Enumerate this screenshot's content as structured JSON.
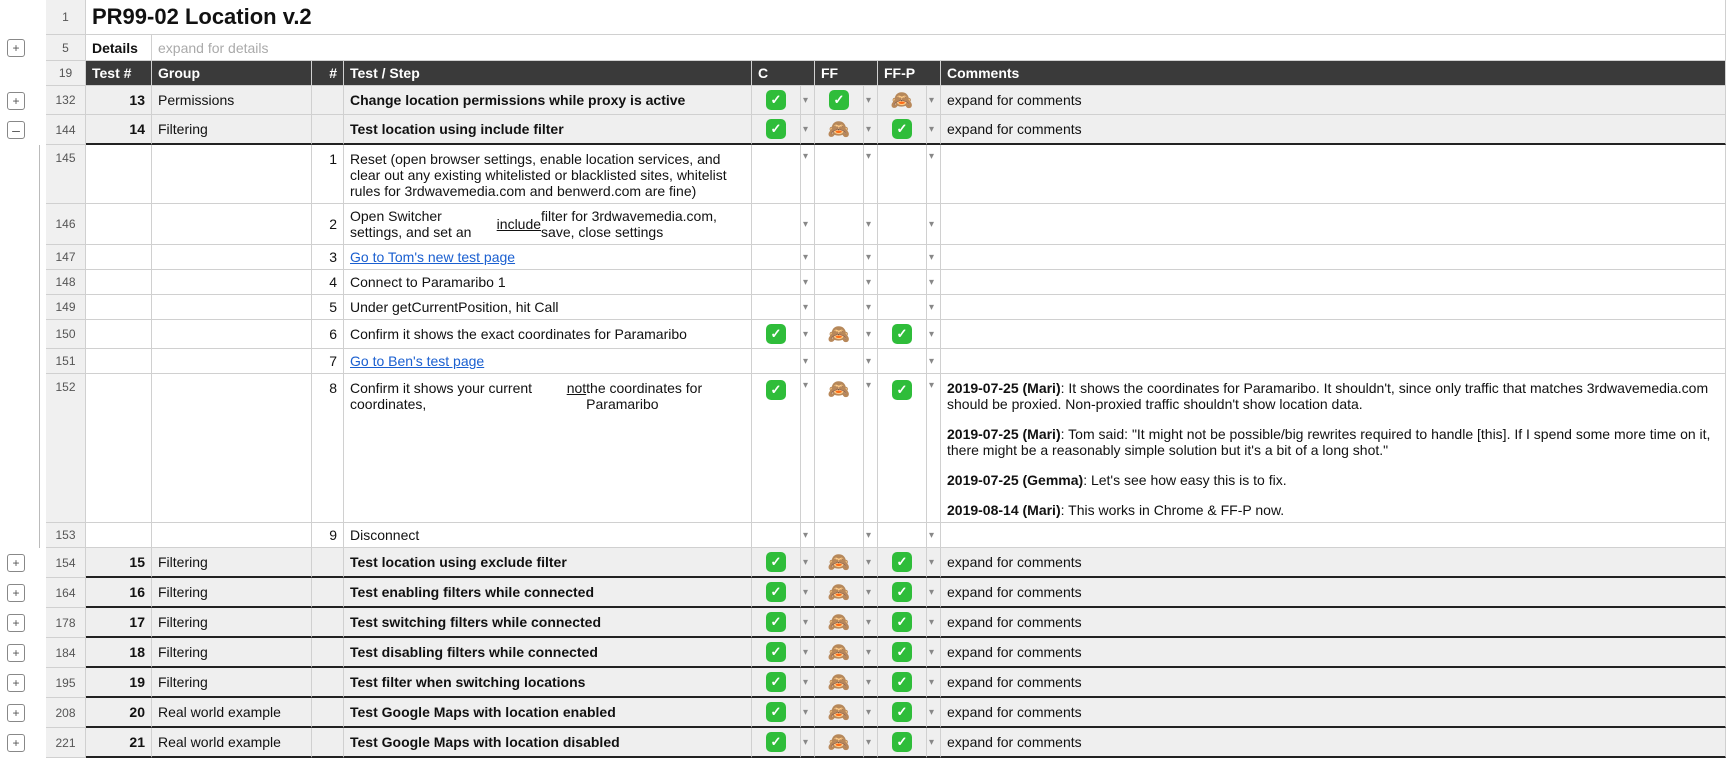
{
  "icons": {
    "pass": "✓",
    "monkey": "🙈",
    "dd": "▾",
    "plus": "+",
    "minus": "–"
  },
  "title": "PR99-02 Location v.2",
  "detailsLabel": "Details",
  "detailsHint": "expand for details",
  "headers": {
    "test": "Test #",
    "group": "Group",
    "num": "#",
    "step": "Test / Step",
    "c": "C",
    "ff": "FF",
    "ffp": "FF-P",
    "comments": "Comments"
  },
  "rownums": {
    "r1": "1",
    "r5": "5",
    "r19": "19"
  },
  "expandComments": "expand for comments",
  "rows": [
    {
      "rn": "132",
      "test": "13",
      "group": "Permissions",
      "num": "",
      "step": "Change location permissions while proxy is active",
      "bold": true,
      "sec": true,
      "c": "pass",
      "ff": "pass",
      "ffp": "monkey",
      "comments": "expand"
    },
    {
      "rn": "144",
      "test": "14",
      "group": "Filtering",
      "num": "",
      "step": "Test location using include filter",
      "bold": true,
      "sec": true,
      "c": "pass",
      "ff": "monkey",
      "ffp": "pass",
      "comments": "expand",
      "topb": true
    },
    {
      "rn": "145",
      "test": "",
      "group": "",
      "num": "1",
      "step": "Reset (open browser settings, enable location services, and clear out any existing whitelisted or blacklisted sites, whitelist rules for 3rdwavemedia.com and benwerd.com are fine)",
      "tall": true
    },
    {
      "rn": "146",
      "test": "",
      "group": "",
      "num": "2",
      "stepParts": [
        "Open Switcher settings, and set an ",
        {
          "u": "include"
        },
        " filter for 3rdwavemedia.com, save, close settings"
      ]
    },
    {
      "rn": "147",
      "test": "",
      "group": "",
      "num": "3",
      "stepLink": "Go to Tom's new test page"
    },
    {
      "rn": "148",
      "test": "",
      "group": "",
      "num": "4",
      "step": "Connect to Paramaribo 1"
    },
    {
      "rn": "149",
      "test": "",
      "group": "",
      "num": "5",
      "step": "Under getCurrentPosition, hit Call"
    },
    {
      "rn": "150",
      "test": "",
      "group": "",
      "num": "6",
      "step": "Confirm it shows the exact coordinates for Paramaribo",
      "c": "pass",
      "ff": "monkey",
      "ffp": "pass"
    },
    {
      "rn": "151",
      "test": "",
      "group": "",
      "num": "7",
      "stepLink": "Go to Ben's test page"
    },
    {
      "rn": "152",
      "test": "",
      "group": "",
      "num": "8",
      "stepParts": [
        "Confirm it shows your current coordinates, ",
        {
          "u": "not"
        },
        " the coordinates for Paramaribo"
      ],
      "c": "pass",
      "ff": "monkey",
      "ffp": "pass",
      "commentsRich": [
        {
          "b": "2019-07-25 (Mari)",
          "t": ": It shows the coordinates for Paramaribo. It shouldn't, since only traffic that matches 3rdwavemedia.com should be proxied. Non-proxied traffic shouldn't show location data."
        },
        {
          "b": "2019-07-25 (Mari)",
          "t": ": Tom said: \"It might not be possible/big rewrites required to handle [this]. If I spend some more time on it, there might be a reasonably simple solution but it's a bit of a long shot.\""
        },
        {
          "b": "2019-07-25 (Gemma)",
          "t": ": Let's see how easy this is to fix."
        },
        {
          "b": "2019-08-14 (Mari)",
          "t": ": This works in Chrome & FF-P now."
        }
      ],
      "tall": true
    },
    {
      "rn": "153",
      "test": "",
      "group": "",
      "num": "9",
      "step": "Disconnect"
    },
    {
      "rn": "154",
      "test": "15",
      "group": "Filtering",
      "num": "",
      "step": "Test location using exclude filter",
      "bold": true,
      "sec": true,
      "c": "pass",
      "ff": "monkey",
      "ffp": "pass",
      "comments": "expand",
      "topb": true,
      "plus": true
    },
    {
      "rn": "164",
      "test": "16",
      "group": "Filtering",
      "num": "",
      "step": "Test enabling filters while connected",
      "bold": true,
      "sec": true,
      "c": "pass",
      "ff": "monkey",
      "ffp": "pass",
      "comments": "expand",
      "topb": true,
      "plus": true
    },
    {
      "rn": "178",
      "test": "17",
      "group": "Filtering",
      "num": "",
      "step": "Test switching filters while connected",
      "bold": true,
      "sec": true,
      "c": "pass",
      "ff": "monkey",
      "ffp": "pass",
      "comments": "expand",
      "topb": true,
      "plus": true
    },
    {
      "rn": "184",
      "test": "18",
      "group": "Filtering",
      "num": "",
      "step": "Test disabling filters while connected",
      "bold": true,
      "sec": true,
      "c": "pass",
      "ff": "monkey",
      "ffp": "pass",
      "comments": "expand",
      "topb": true,
      "plus": true
    },
    {
      "rn": "195",
      "test": "19",
      "group": "Filtering",
      "num": "",
      "step": "Test filter when switching locations",
      "bold": true,
      "sec": true,
      "c": "pass",
      "ff": "monkey",
      "ffp": "pass",
      "comments": "expand",
      "topb": true,
      "plus": true
    },
    {
      "rn": "208",
      "test": "20",
      "group": "Real world example",
      "num": "",
      "step": "Test Google Maps with location enabled",
      "bold": true,
      "sec": true,
      "c": "pass",
      "ff": "monkey",
      "ffp": "pass",
      "comments": "expand",
      "topb": true,
      "plus": true
    },
    {
      "rn": "221",
      "test": "21",
      "group": "Real world example",
      "num": "",
      "step": "Test Google Maps with location disabled",
      "bold": true,
      "sec": true,
      "c": "pass",
      "ff": "monkey",
      "ffp": "pass",
      "comments": "expand",
      "topb": true,
      "plus": true
    }
  ]
}
